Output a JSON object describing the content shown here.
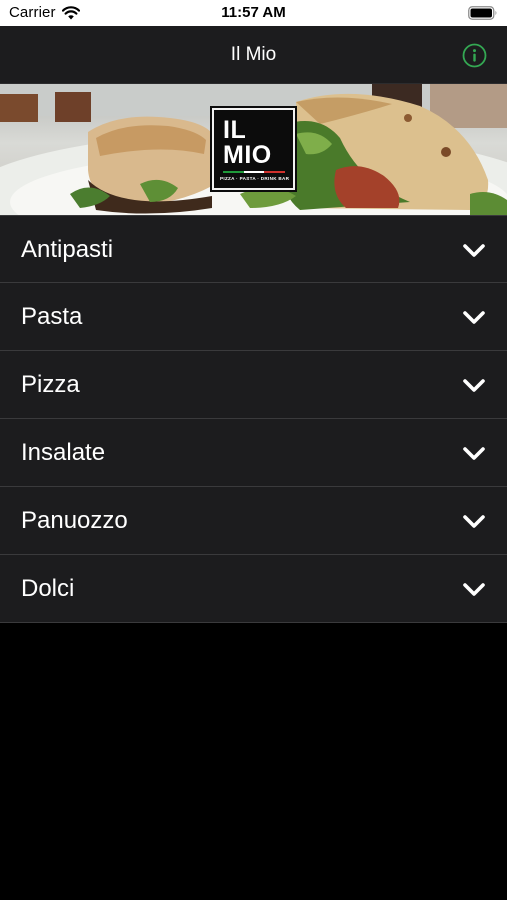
{
  "status_bar": {
    "carrier": "Carrier",
    "time": "11:57 AM"
  },
  "nav": {
    "title": "Il Mio",
    "info_icon": "info-circle-icon",
    "accent_color": "#34a853"
  },
  "hero": {
    "logo_line1": "IL",
    "logo_line2": "MIO",
    "logo_tagline": "PIZZA · PASTA · DRINK BAR",
    "logo_bar_colors": [
      "#1f9a3a",
      "#ffffff",
      "#d0312d"
    ]
  },
  "menu": {
    "categories": [
      {
        "label": "Antipasti",
        "icon": "chevron-down-icon"
      },
      {
        "label": "Pasta",
        "icon": "chevron-down-icon"
      },
      {
        "label": "Pizza",
        "icon": "chevron-down-icon"
      },
      {
        "label": "Insalate",
        "icon": "chevron-down-icon"
      },
      {
        "label": "Panuozzo",
        "icon": "chevron-down-icon"
      },
      {
        "label": "Dolci",
        "icon": "chevron-down-icon"
      }
    ]
  },
  "colors": {
    "background": "#000000",
    "bar": "#1c1c1e",
    "separator": "#3a3a3c",
    "text": "#ffffff"
  }
}
